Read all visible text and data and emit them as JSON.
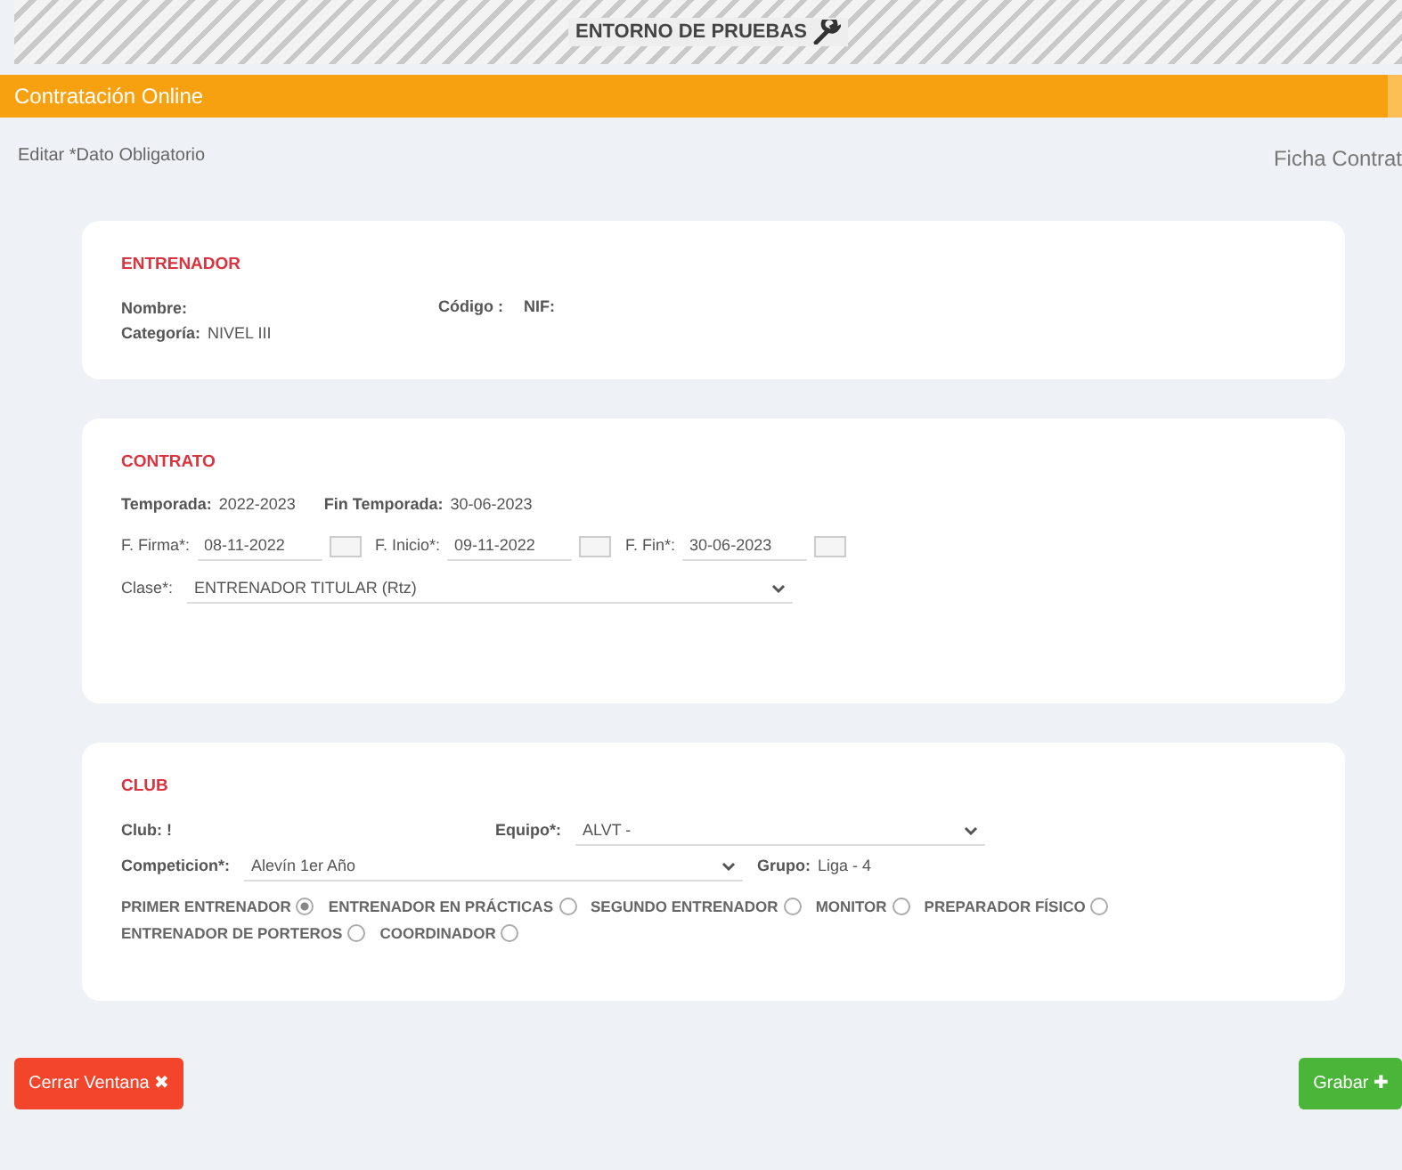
{
  "banner": {
    "title": "ENTORNO DE PRUEBAS"
  },
  "header": {
    "title": "Contratación Online"
  },
  "subheader": {
    "left": "Editar  *Dato Obligatorio",
    "right": "Ficha Contrat"
  },
  "entrenador": {
    "title": "ENTRENADOR",
    "nombre_label": "Nombre:",
    "codigo_label": "Código :",
    "nif_label": "NIF:",
    "categoria_label": "Categoría:",
    "categoria": "NIVEL III"
  },
  "contrato": {
    "title": "CONTRATO",
    "temporada_label": "Temporada:",
    "temporada": "2022-2023",
    "fin_label": "Fin Temporada:",
    "fin": "30-06-2023",
    "dates": [
      {
        "label": "F. Firma*:",
        "value": "08-11-2022"
      },
      {
        "label": "F. Inicio*:",
        "value": "09-11-2022"
      },
      {
        "label": "F. Fin*:",
        "value": "30-06-2023"
      }
    ],
    "clase_label": "Clase*:",
    "clase": "ENTRENADOR TITULAR (Rtz)"
  },
  "club": {
    "title": "CLUB",
    "club_label": "Club: !",
    "equipo_label": "Equipo*:",
    "equipo": "ALVT -",
    "competicion_label": "Competicion*:",
    "competicion": "Alevín 1er Año",
    "grupo_label": "Grupo:",
    "grupo": "Liga - 4",
    "roles": [
      {
        "label": "PRIMER ENTRENADOR",
        "selected": true
      },
      {
        "label": "ENTRENADOR EN PRÁCTICAS",
        "selected": false
      },
      {
        "label": "SEGUNDO ENTRENADOR",
        "selected": false
      },
      {
        "label": "MONITOR",
        "selected": false
      },
      {
        "label": "PREPARADOR FÍSICO",
        "selected": false
      },
      {
        "label": "ENTRENADOR DE PORTEROS",
        "selected": false
      },
      {
        "label": "COORDINADOR",
        "selected": false
      }
    ]
  },
  "buttons": {
    "close": "Cerrar Ventana ✖",
    "save": "Grabar ✚"
  }
}
